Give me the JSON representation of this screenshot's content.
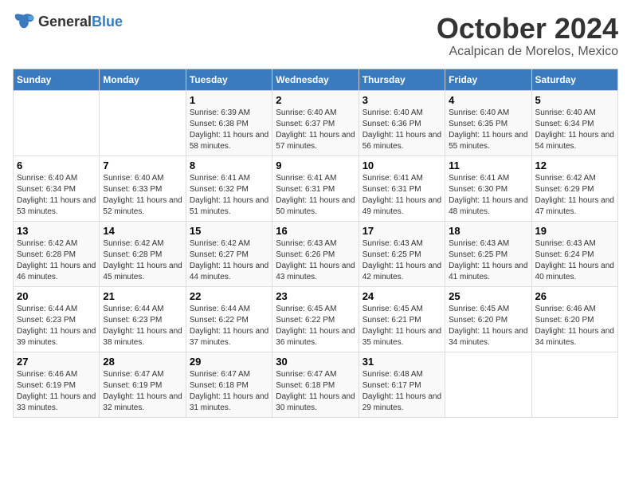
{
  "logo": {
    "text_general": "General",
    "text_blue": "Blue"
  },
  "header": {
    "title": "October 2024",
    "subtitle": "Acalpican de Morelos, Mexico"
  },
  "weekdays": [
    "Sunday",
    "Monday",
    "Tuesday",
    "Wednesday",
    "Thursday",
    "Friday",
    "Saturday"
  ],
  "weeks": [
    [
      {
        "day": "",
        "info": ""
      },
      {
        "day": "",
        "info": ""
      },
      {
        "day": "1",
        "info": "Sunrise: 6:39 AM\nSunset: 6:38 PM\nDaylight: 11 hours and 58 minutes."
      },
      {
        "day": "2",
        "info": "Sunrise: 6:40 AM\nSunset: 6:37 PM\nDaylight: 11 hours and 57 minutes."
      },
      {
        "day": "3",
        "info": "Sunrise: 6:40 AM\nSunset: 6:36 PM\nDaylight: 11 hours and 56 minutes."
      },
      {
        "day": "4",
        "info": "Sunrise: 6:40 AM\nSunset: 6:35 PM\nDaylight: 11 hours and 55 minutes."
      },
      {
        "day": "5",
        "info": "Sunrise: 6:40 AM\nSunset: 6:34 PM\nDaylight: 11 hours and 54 minutes."
      }
    ],
    [
      {
        "day": "6",
        "info": "Sunrise: 6:40 AM\nSunset: 6:34 PM\nDaylight: 11 hours and 53 minutes."
      },
      {
        "day": "7",
        "info": "Sunrise: 6:40 AM\nSunset: 6:33 PM\nDaylight: 11 hours and 52 minutes."
      },
      {
        "day": "8",
        "info": "Sunrise: 6:41 AM\nSunset: 6:32 PM\nDaylight: 11 hours and 51 minutes."
      },
      {
        "day": "9",
        "info": "Sunrise: 6:41 AM\nSunset: 6:31 PM\nDaylight: 11 hours and 50 minutes."
      },
      {
        "day": "10",
        "info": "Sunrise: 6:41 AM\nSunset: 6:31 PM\nDaylight: 11 hours and 49 minutes."
      },
      {
        "day": "11",
        "info": "Sunrise: 6:41 AM\nSunset: 6:30 PM\nDaylight: 11 hours and 48 minutes."
      },
      {
        "day": "12",
        "info": "Sunrise: 6:42 AM\nSunset: 6:29 PM\nDaylight: 11 hours and 47 minutes."
      }
    ],
    [
      {
        "day": "13",
        "info": "Sunrise: 6:42 AM\nSunset: 6:28 PM\nDaylight: 11 hours and 46 minutes."
      },
      {
        "day": "14",
        "info": "Sunrise: 6:42 AM\nSunset: 6:28 PM\nDaylight: 11 hours and 45 minutes."
      },
      {
        "day": "15",
        "info": "Sunrise: 6:42 AM\nSunset: 6:27 PM\nDaylight: 11 hours and 44 minutes."
      },
      {
        "day": "16",
        "info": "Sunrise: 6:43 AM\nSunset: 6:26 PM\nDaylight: 11 hours and 43 minutes."
      },
      {
        "day": "17",
        "info": "Sunrise: 6:43 AM\nSunset: 6:25 PM\nDaylight: 11 hours and 42 minutes."
      },
      {
        "day": "18",
        "info": "Sunrise: 6:43 AM\nSunset: 6:25 PM\nDaylight: 11 hours and 41 minutes."
      },
      {
        "day": "19",
        "info": "Sunrise: 6:43 AM\nSunset: 6:24 PM\nDaylight: 11 hours and 40 minutes."
      }
    ],
    [
      {
        "day": "20",
        "info": "Sunrise: 6:44 AM\nSunset: 6:23 PM\nDaylight: 11 hours and 39 minutes."
      },
      {
        "day": "21",
        "info": "Sunrise: 6:44 AM\nSunset: 6:23 PM\nDaylight: 11 hours and 38 minutes."
      },
      {
        "day": "22",
        "info": "Sunrise: 6:44 AM\nSunset: 6:22 PM\nDaylight: 11 hours and 37 minutes."
      },
      {
        "day": "23",
        "info": "Sunrise: 6:45 AM\nSunset: 6:22 PM\nDaylight: 11 hours and 36 minutes."
      },
      {
        "day": "24",
        "info": "Sunrise: 6:45 AM\nSunset: 6:21 PM\nDaylight: 11 hours and 35 minutes."
      },
      {
        "day": "25",
        "info": "Sunrise: 6:45 AM\nSunset: 6:20 PM\nDaylight: 11 hours and 34 minutes."
      },
      {
        "day": "26",
        "info": "Sunrise: 6:46 AM\nSunset: 6:20 PM\nDaylight: 11 hours and 34 minutes."
      }
    ],
    [
      {
        "day": "27",
        "info": "Sunrise: 6:46 AM\nSunset: 6:19 PM\nDaylight: 11 hours and 33 minutes."
      },
      {
        "day": "28",
        "info": "Sunrise: 6:47 AM\nSunset: 6:19 PM\nDaylight: 11 hours and 32 minutes."
      },
      {
        "day": "29",
        "info": "Sunrise: 6:47 AM\nSunset: 6:18 PM\nDaylight: 11 hours and 31 minutes."
      },
      {
        "day": "30",
        "info": "Sunrise: 6:47 AM\nSunset: 6:18 PM\nDaylight: 11 hours and 30 minutes."
      },
      {
        "day": "31",
        "info": "Sunrise: 6:48 AM\nSunset: 6:17 PM\nDaylight: 11 hours and 29 minutes."
      },
      {
        "day": "",
        "info": ""
      },
      {
        "day": "",
        "info": ""
      }
    ]
  ]
}
